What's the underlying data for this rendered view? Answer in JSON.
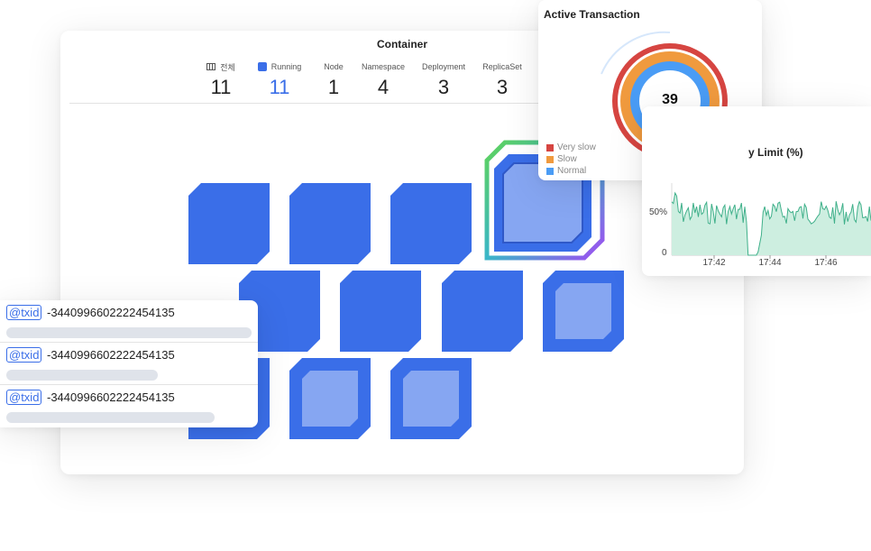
{
  "container": {
    "title": "Container",
    "stats": [
      {
        "label": "전체",
        "value": "11",
        "icon": "grid-icon"
      },
      {
        "label": "Running",
        "value": "11",
        "icon": "running-square-icon"
      },
      {
        "label": "Node",
        "value": "1"
      },
      {
        "label": "Namespace",
        "value": "4"
      },
      {
        "label": "Deployment",
        "value": "3"
      },
      {
        "label": "ReplicaSet",
        "value": "3"
      }
    ],
    "running_color": "#3a6ee8"
  },
  "active_transaction": {
    "title": "Active Transaction",
    "count": "39",
    "legend": [
      {
        "label": "Very slow",
        "color": "#d64541"
      },
      {
        "label": "Slow",
        "color": "#f09a3e"
      },
      {
        "label": "Normal",
        "color": "#4a9cf5"
      }
    ]
  },
  "memory_chart": {
    "title_visible": "y Limit (%)",
    "y_ticks": [
      "50%",
      "0"
    ],
    "x_ticks": [
      "17:42",
      "17:44",
      "17:46"
    ],
    "line_color": "#3fb08a"
  },
  "txid": {
    "rows": [
      {
        "tag": "@txid",
        "id": "-3440996602222454135"
      },
      {
        "tag": "@txid",
        "id": "-3440996602222454135"
      },
      {
        "tag": "@txid",
        "id": "-3440996602222454135"
      }
    ]
  }
}
